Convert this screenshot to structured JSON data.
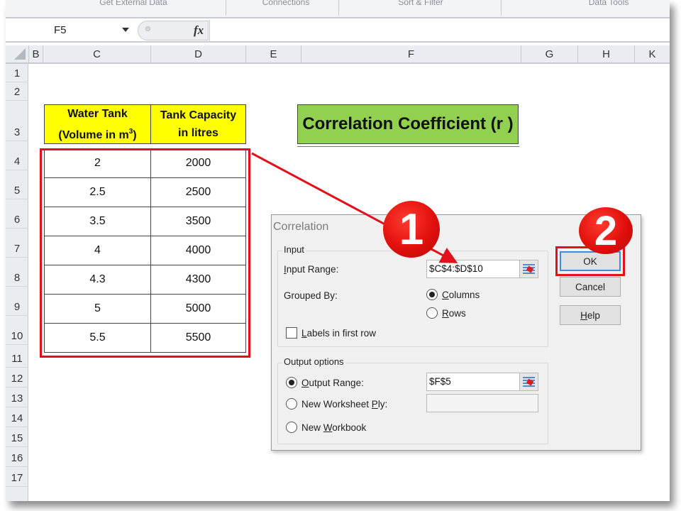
{
  "ribbon": {
    "groups": [
      "Get External Data",
      "Connections",
      "Sort & Filter",
      "Data Tools"
    ]
  },
  "formula_bar": {
    "name_box": "F5",
    "fx_label": "fx",
    "formula": ""
  },
  "columns": [
    "B",
    "C",
    "D",
    "E",
    "F",
    "G",
    "H",
    "K"
  ],
  "rows": [
    "1",
    "2",
    "3",
    "4",
    "5",
    "6",
    "7",
    "8",
    "9",
    "10",
    "11",
    "12",
    "13",
    "14",
    "15",
    "16",
    "17"
  ],
  "table": {
    "headers": {
      "col1_line1": "Water Tank",
      "col1_line2": "(Volume in m",
      "col1_sup": "3",
      "col1_close": ")",
      "col2_line1": "Tank Capacity",
      "col2_line2": "in litres"
    },
    "rows": [
      {
        "volume": "2",
        "capacity": "2000"
      },
      {
        "volume": "2.5",
        "capacity": "2500"
      },
      {
        "volume": "3.5",
        "capacity": "3500"
      },
      {
        "volume": "4",
        "capacity": "4000"
      },
      {
        "volume": "4.3",
        "capacity": "4300"
      },
      {
        "volume": "5",
        "capacity": "5000"
      },
      {
        "volume": "5.5",
        "capacity": "5500"
      }
    ]
  },
  "title_box": "Correlation Coefficient (r )",
  "dialog": {
    "title": "Correlation",
    "input_group": "Input",
    "input_range_label_u": "I",
    "input_range_label_rest": "nput Range:",
    "input_range_value": "$C$4:$D$10",
    "grouped_by_label": "Grouped By:",
    "columns_u": "C",
    "columns_rest": "olumns",
    "rows_u": "R",
    "rows_rest": "ows",
    "grouped_by_selected": "Columns",
    "labels_u": "L",
    "labels_rest": "abels in first row",
    "labels_checked": false,
    "output_group": "Output options",
    "output_range_u": "O",
    "output_range_rest": "utput Range:",
    "output_range_value": "$F$5",
    "new_ws_pre": "New Worksheet ",
    "new_ws_u": "P",
    "new_ws_rest": "ly:",
    "new_ws_value": "",
    "new_wb_pre": "New ",
    "new_wb_u": "W",
    "new_wb_rest": "orkbook",
    "output_selected": "Output Range",
    "ok_label": "OK",
    "cancel_label": "Cancel",
    "help_u": "H",
    "help_rest": "elp"
  },
  "annotations": {
    "step1": "1",
    "step2": "2",
    "highlight_color": "#e3101b"
  }
}
